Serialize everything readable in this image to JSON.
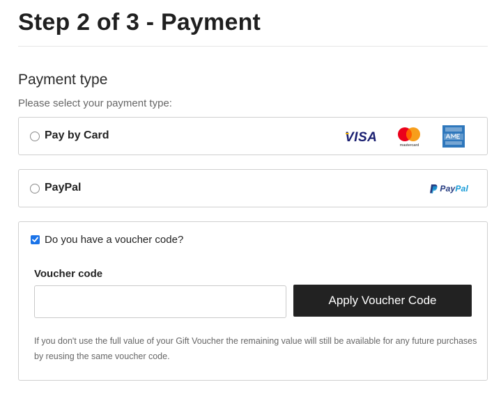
{
  "header": {
    "title": "Step 2 of 3 - Payment"
  },
  "payment_section": {
    "title": "Payment type",
    "subtitle": "Please select your payment type:"
  },
  "options": {
    "card": {
      "label": "Pay by Card",
      "selected": false,
      "logos": [
        "visa-logo",
        "mastercard-logo",
        "amex-logo"
      ],
      "visa_text": "VISA",
      "mastercard_text": "mastercard"
    },
    "paypal": {
      "label": "PayPal",
      "selected": false,
      "logo_text_dark": "Pay",
      "logo_text_light": "Pal"
    }
  },
  "voucher": {
    "checkbox_label": "Do you have a voucher code?",
    "checked": true,
    "field_label": "Voucher code",
    "input_value": "",
    "input_placeholder": "",
    "button_label": "Apply Voucher Code",
    "note": "If you don't use the full value of your Gift Voucher the remaining value will still be available for any future purchases by reusing the same voucher code."
  },
  "colors": {
    "button_bg": "#222222",
    "checkbox": "#1a73e8",
    "visa_blue": "#1a1f71",
    "visa_gold": "#f7b600",
    "mc_red": "#eb001b",
    "mc_orange": "#f79e1b",
    "amex_blue": "#2e77bc",
    "paypal_dark": "#253b80",
    "paypal_light": "#179bd7"
  }
}
